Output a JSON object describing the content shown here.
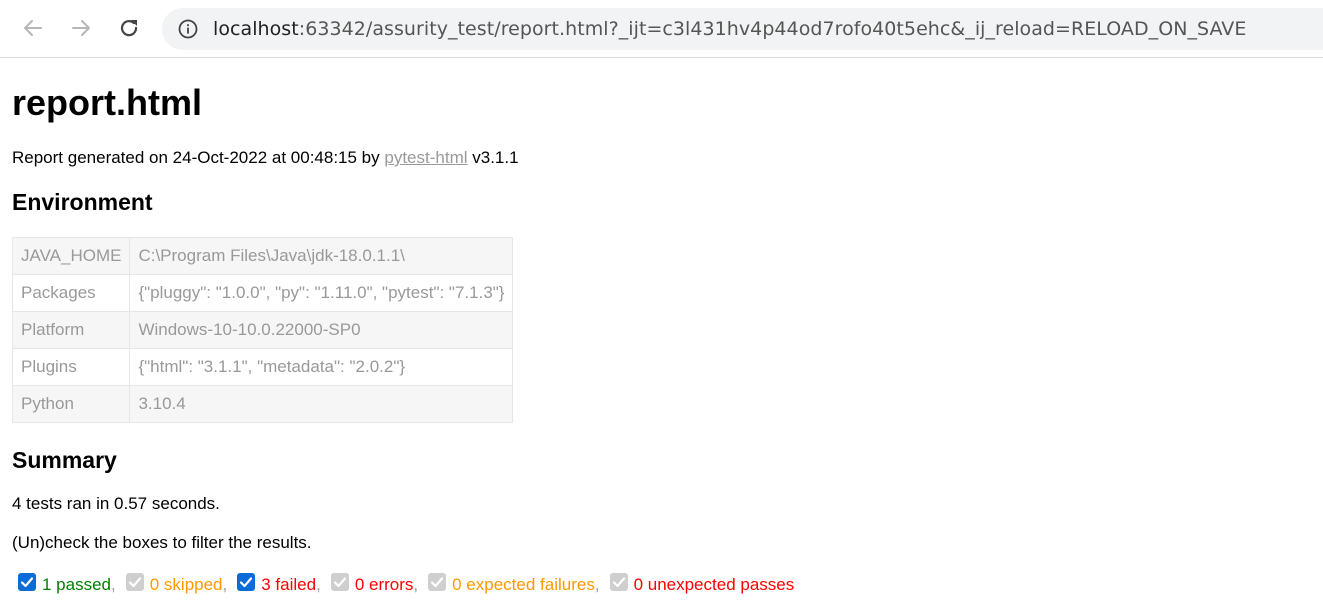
{
  "browser": {
    "url_host": "localhost",
    "url_rest": ":63342/assurity_test/report.html?_ijt=c3l431hv4p44od7rofo40t5ehc&_ij_reload=RELOAD_ON_SAVE",
    "icons": [
      "back-arrow-icon",
      "forward-arrow-icon",
      "reload-icon",
      "info-icon"
    ]
  },
  "report": {
    "title": "report.html",
    "generated_prefix": "Report generated on 24-Oct-2022 at 00:48:15 by ",
    "generated_link": "pytest-html",
    "generated_suffix": " v3.1.1"
  },
  "environment": {
    "heading": "Environment",
    "rows": [
      {
        "key": "JAVA_HOME",
        "value": "C:\\Program Files\\Java\\jdk-18.0.1.1\\"
      },
      {
        "key": "Packages",
        "value": "{\"pluggy\": \"1.0.0\", \"py\": \"1.11.0\", \"pytest\": \"7.1.3\"}"
      },
      {
        "key": "Platform",
        "value": "Windows-10-10.0.22000-SP0"
      },
      {
        "key": "Plugins",
        "value": "{\"html\": \"3.1.1\", \"metadata\": \"2.0.2\"}"
      },
      {
        "key": "Python",
        "value": "3.10.4"
      }
    ]
  },
  "summary": {
    "heading": "Summary",
    "ran_text": "4 tests ran in 0.57 seconds.",
    "filter_hint": "(Un)check the boxes to filter the results.",
    "separator": ",",
    "filters": [
      {
        "label": "1 passed",
        "checked": true,
        "color": "#008000"
      },
      {
        "label": "0 skipped",
        "checked": false,
        "color": "#ff9900"
      },
      {
        "label": "3 failed",
        "checked": true,
        "color": "#ff0000"
      },
      {
        "label": "0 errors",
        "checked": false,
        "color": "#ff0000"
      },
      {
        "label": "0 expected failures",
        "checked": false,
        "color": "#ff9900"
      },
      {
        "label": "0 unexpected passes",
        "checked": false,
        "color": "#ff0000"
      }
    ]
  }
}
